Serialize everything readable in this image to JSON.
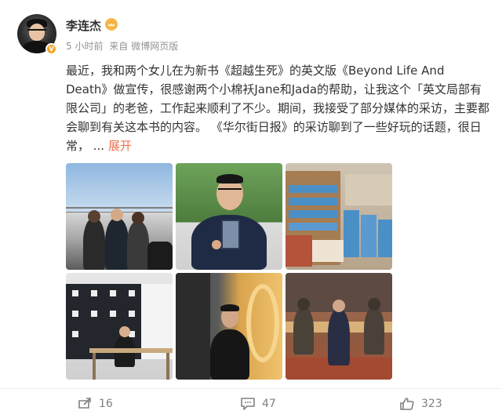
{
  "user": {
    "name": "李连杰",
    "time": "5 小时前",
    "source_prefix": "来自",
    "source": "微博网页版",
    "badge": "V"
  },
  "post": {
    "text": "最近，我和两个女儿在为新书《超越生死》的英文版《Beyond Life And Death》做宣传，很感谢两个小棉袄Jane和Jada的帮助，让我这个「英文局部有限公司」的老爸，工作起来顺利了不少。期间，我接受了部分媒体的采访，主要都会聊到有关这本书的内容。 《华尔街日报》的采访聊到了一些好玩的话题，很日常，  ...",
    "expand_label": "展开"
  },
  "photos": [
    "photo-1",
    "photo-2",
    "photo-3",
    "photo-4",
    "photo-5",
    "photo-6"
  ],
  "actions": {
    "repost_count": "16",
    "comment_count": "47",
    "like_count": "323"
  },
  "colors": {
    "accent": "#eb7350",
    "meta": "#939393",
    "icon": "#808080",
    "vip": "#f5a623"
  },
  "icons": [
    "crown-icon",
    "verified-badge-icon",
    "repost-icon",
    "comment-icon",
    "like-icon"
  ]
}
